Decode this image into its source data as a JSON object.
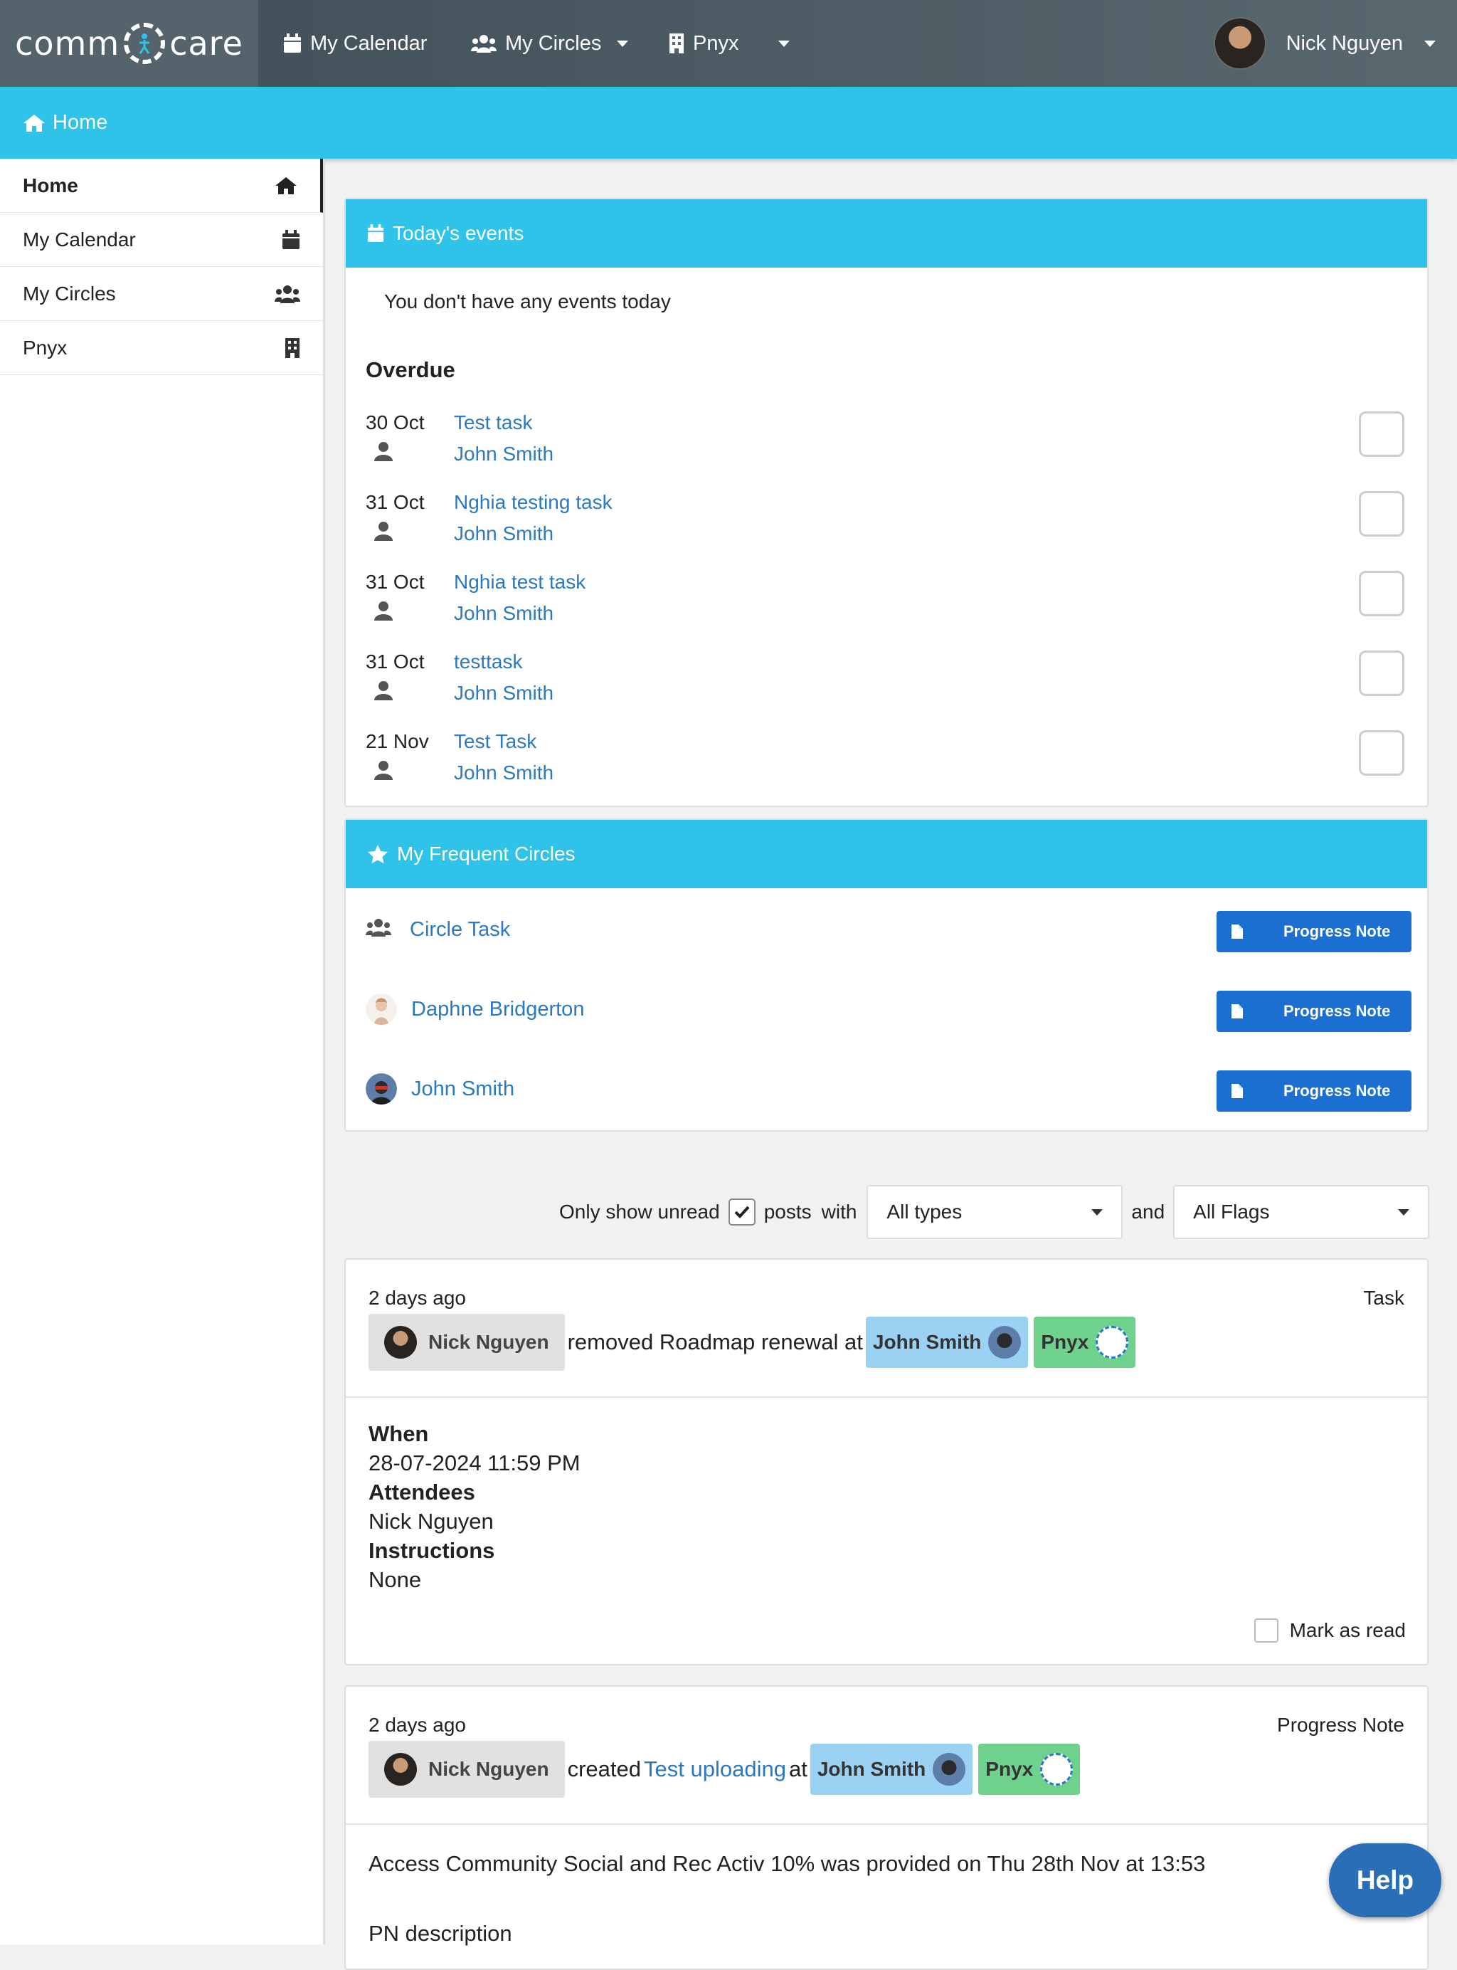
{
  "brand": {
    "left": "comm",
    "right": "care"
  },
  "topnav": {
    "calendar": "My Calendar",
    "circles": "My Circles",
    "org": "Pnyx",
    "user": "Nick Nguyen"
  },
  "breadcrumb": "Home",
  "sidebar": {
    "items": [
      {
        "label": "Home",
        "icon": "home-icon"
      },
      {
        "label": "My Calendar",
        "icon": "calendar-icon"
      },
      {
        "label": "My Circles",
        "icon": "users-icon"
      },
      {
        "label": "Pnyx",
        "icon": "building-icon"
      }
    ]
  },
  "todays_events": {
    "title": "Today's events",
    "empty_text": "You don't have any events today",
    "overdue_label": "Overdue",
    "tasks": [
      {
        "date": "30 Oct",
        "title": "Test task",
        "who": "John Smith"
      },
      {
        "date": "31 Oct",
        "title": "Nghia testing task",
        "who": "John Smith"
      },
      {
        "date": "31 Oct",
        "title": "Nghia test task",
        "who": "John Smith"
      },
      {
        "date": "31 Oct",
        "title": "testtask",
        "who": "John Smith"
      },
      {
        "date": "21 Nov",
        "title": "Test Task",
        "who": "John Smith"
      }
    ]
  },
  "frequent_circles": {
    "title": "My Frequent Circles",
    "items": [
      {
        "name": "Circle Task",
        "button": "Progress Note"
      },
      {
        "name": "Daphne Bridgerton",
        "button": "Progress Note"
      },
      {
        "name": "John Smith",
        "button": "Progress Note"
      }
    ]
  },
  "filter": {
    "only_unread": "Only show unread",
    "posts": "posts",
    "with": "with",
    "types": "All types",
    "and": "and",
    "flags": "All Flags"
  },
  "posts": [
    {
      "time": "2 days ago",
      "kind": "Task",
      "actor": "Nick Nguyen",
      "action": "removed Roadmap renewal at",
      "target": "John Smith",
      "org": "Pnyx",
      "when_label": "When",
      "when": "28-07-2024 11:59 PM",
      "attendees_label": "Attendees",
      "attendees": "Nick Nguyen",
      "instructions_label": "Instructions",
      "instructions": "None",
      "mark_read": "Mark as read"
    },
    {
      "time": "2 days ago",
      "kind": "Progress Note",
      "actor": "Nick Nguyen",
      "action": "created",
      "link": "Test uploading",
      "at": "at",
      "target": "John Smith",
      "org": "Pnyx",
      "body": "Access Community Social and Rec Activ 10% was provided on Thu 28th Nov at 13:53",
      "description": "PN description"
    }
  ],
  "help": "Help",
  "colors": {
    "accent": "#2fc3ea",
    "button": "#1b6fd0",
    "link": "#2a79c4",
    "chip_blue": "#9bd1f2",
    "chip_green": "#6fd28c"
  }
}
